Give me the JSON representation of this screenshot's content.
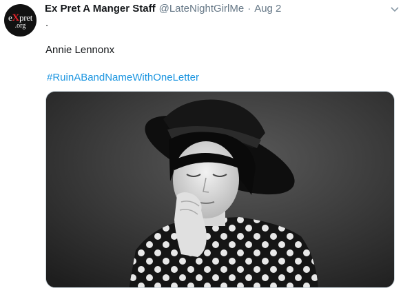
{
  "tweet": {
    "author_name": "Ex Pret A Manger Staff",
    "handle": "@LateNightGirlMe",
    "separator": "·",
    "date": "Aug 2",
    "text_line1": ".",
    "text_line2": "Annie Lennonx",
    "hashtag": "#RuinABandNameWithOneLetter"
  },
  "avatar": {
    "logo_prefix": "e",
    "logo_x": "X",
    "logo_suffix": "pret",
    "logo_sub": ".org",
    "colors": {
      "background": "#111111",
      "accent": "#e0242a"
    }
  },
  "icons": {
    "menu": "chevron-down-icon"
  },
  "colors": {
    "link": "#1b95e0",
    "secondary": "#657786"
  }
}
